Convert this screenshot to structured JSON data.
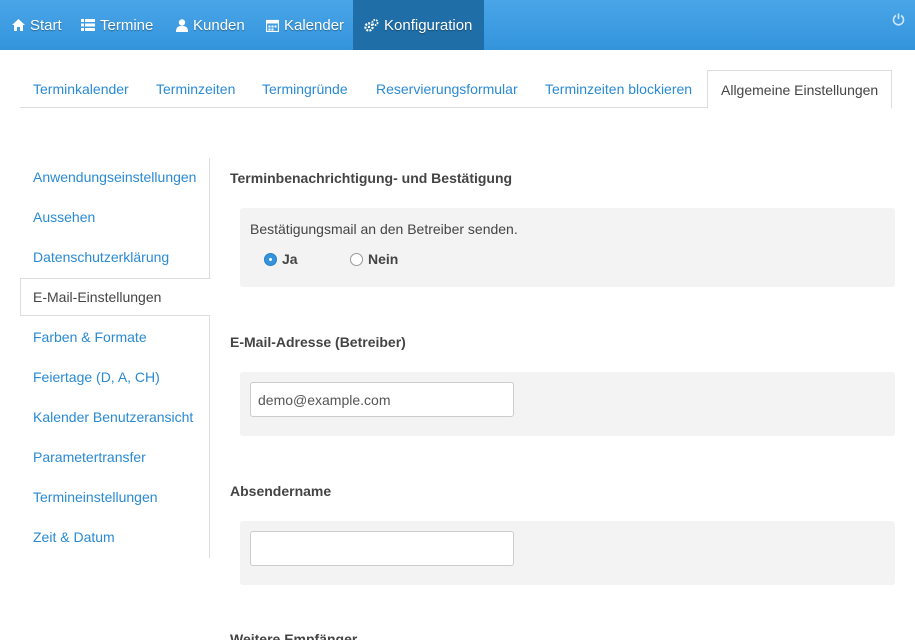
{
  "navbar": {
    "items": [
      {
        "label": "Start",
        "icon": "home-icon"
      },
      {
        "label": "Termine",
        "icon": "list-icon"
      },
      {
        "label": "Kunden",
        "icon": "user-icon"
      },
      {
        "label": "Kalender",
        "icon": "calendar-icon"
      },
      {
        "label": "Konfiguration",
        "icon": "cogs-icon",
        "active": true
      }
    ],
    "power_icon": "power-icon",
    "bg_color": "#3394dc",
    "active_color": "#1f6ea8"
  },
  "tabs": [
    {
      "label": "Terminkalender"
    },
    {
      "label": "Terminzeiten"
    },
    {
      "label": "Termingründe"
    },
    {
      "label": "Reservierungsformular"
    },
    {
      "label": "Terminzeiten blockieren"
    },
    {
      "label": "Allgemeine Einstellungen",
      "active": true
    }
  ],
  "sidebar": {
    "items": [
      {
        "label": "Anwendungseinstellungen"
      },
      {
        "label": "Aussehen"
      },
      {
        "label": "Datenschutzerklärung"
      },
      {
        "label": "E-Mail-Einstellungen",
        "active": true
      },
      {
        "label": "Farben & Formate"
      },
      {
        "label": "Feiertage (D, A, CH)"
      },
      {
        "label": "Kalender Benutzeransicht"
      },
      {
        "label": "Parametertransfer"
      },
      {
        "label": "Termineinstellungen"
      },
      {
        "label": "Zeit & Datum"
      }
    ]
  },
  "sections": {
    "notification": {
      "title": "Terminbenachrichtigung- und Bestätigung",
      "description": "Bestätigungsmail an den Betreiber senden.",
      "options": [
        {
          "label": "Ja",
          "checked": true
        },
        {
          "label": "Nein",
          "checked": false
        }
      ]
    },
    "email": {
      "title": "E-Mail-Adresse (Betreiber)",
      "value": "demo@example.com"
    },
    "sender": {
      "title": "Absendername",
      "value": ""
    },
    "more_recipients": {
      "title": "Weitere Empfänger"
    }
  },
  "colors": {
    "link": "#2a8ad2",
    "panel": "#f3f3f3"
  }
}
